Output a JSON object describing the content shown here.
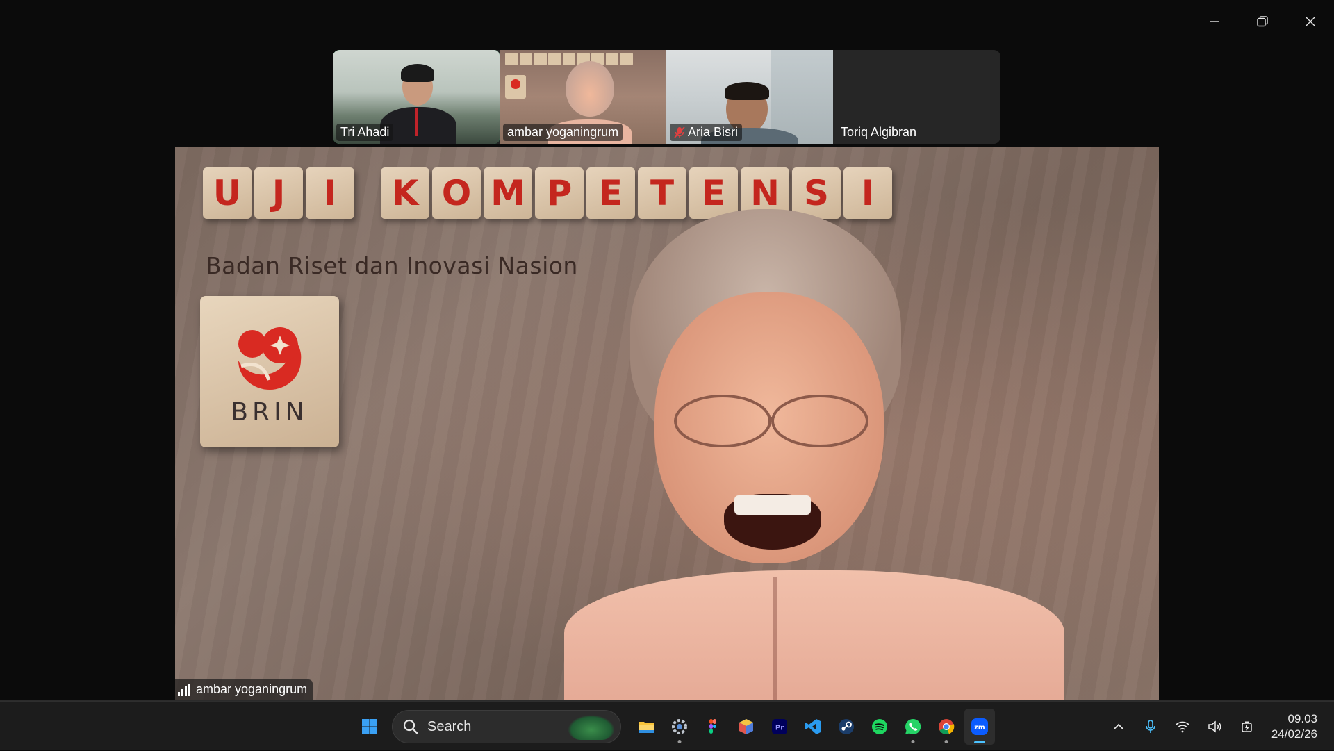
{
  "window": {
    "controls": [
      "minimize",
      "restore",
      "close"
    ]
  },
  "participants": [
    {
      "name": "Tri Ahadi",
      "active_speaker": true,
      "muted": false
    },
    {
      "name": "ambar yoganingrum",
      "active_speaker": false,
      "muted": false
    },
    {
      "name": "Aria Bisri",
      "active_speaker": false,
      "muted": true
    },
    {
      "name": "Toriq Algibran",
      "active_speaker": false,
      "muted": false,
      "video_off": true
    }
  ],
  "main_video": {
    "speaker_name": "ambar yoganingrum",
    "background": {
      "tile_letters_1": [
        "U",
        "J",
        "I"
      ],
      "tile_letters_2": [
        "K",
        "O",
        "M",
        "P",
        "E",
        "T",
        "E",
        "N",
        "S",
        "I"
      ],
      "subtitle": "Badan Riset dan Inovasi Nasion",
      "logo_text": "BRIN"
    }
  },
  "taskbar": {
    "search_placeholder": "Search",
    "apps": [
      "start-icon",
      "file-explorer-icon",
      "settings-icon",
      "figma-icon",
      "app-cube-icon",
      "premiere-pro-icon",
      "vscode-icon",
      "steam-icon",
      "spotify-icon",
      "whatsapp-icon",
      "chrome-icon",
      "zoom-icon"
    ],
    "premiere_label": "Pr",
    "zoom_label": "zm",
    "tray": [
      "chevron-up-icon",
      "microphone-icon",
      "wifi-icon",
      "volume-icon",
      "battery-icon"
    ],
    "time": "09.03",
    "date": "24/02/26"
  },
  "colors": {
    "active_border": "#23d67a",
    "accent": "#4cc2ff",
    "brin_red": "#d92a22"
  }
}
